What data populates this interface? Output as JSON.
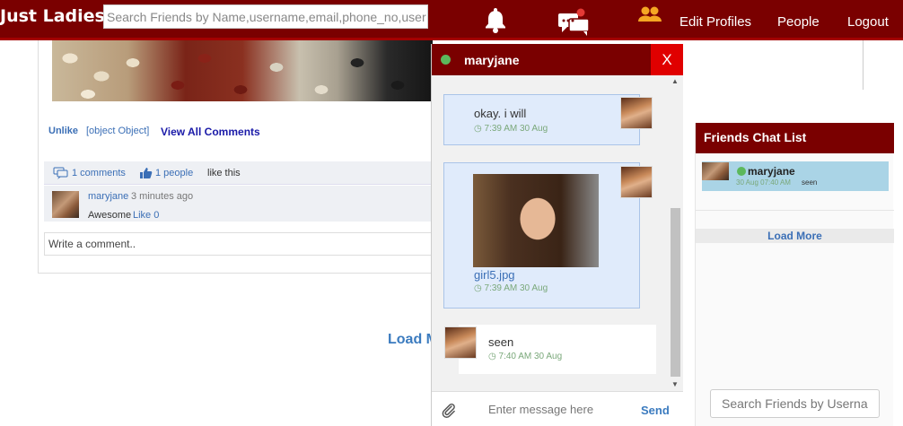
{
  "header": {
    "brand": "Just Ladies",
    "search_placeholder": "Search Friends by Name,username,email,phone_no,user",
    "nav": {
      "edit_profiles": "Edit Profiles",
      "people": "People",
      "logout": "Logout"
    },
    "icons": [
      "bell-icon",
      "chat-bubbles-icon",
      "friends-group-icon"
    ]
  },
  "post": {
    "unlike": "Unlike",
    "comment": {
      "user": "maryjane",
      "time": "3 minutes ago",
      "text": "Awesome",
      "like": "Like 0"
    },
    "view_all": "View All Comments",
    "comments_count": "1 comments",
    "likes_count": "1 people",
    "likes_suffix": "like this",
    "write_placeholder": "Write a comment.."
  },
  "load_more_main": "Load More",
  "chat": {
    "name": "maryjane",
    "close": "X",
    "messages": [
      {
        "text": "okay. i will",
        "time": "7:39 AM 30 Aug"
      },
      {
        "file": "girl5.jpg",
        "time": "7:39 AM 30 Aug"
      },
      {
        "text": "seen",
        "time": "7:40 AM 30 Aug"
      }
    ],
    "input_placeholder": "Enter message here",
    "send": "Send"
  },
  "friends_list": {
    "title": "Friends Chat List",
    "items": [
      {
        "name": "maryjane",
        "meta": "30 Aug 07:40 AM",
        "status": "seen"
      }
    ],
    "load_more": "Load More",
    "search_placeholder": "Search Friends by Userna"
  },
  "colors": {
    "brand": "#7a0000",
    "accent": "#e00000",
    "link": "#3b6fb6",
    "online": "#5cb85c"
  }
}
